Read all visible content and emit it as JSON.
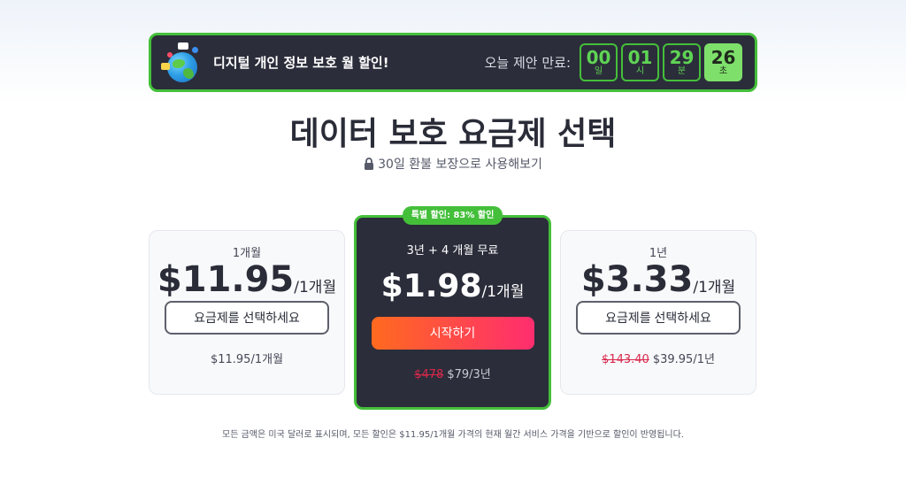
{
  "banner": {
    "text": "디지털 개인 정보 보호 월 할인!",
    "timer_label": "오늘 제안 만료:",
    "timer": [
      {
        "value": "00",
        "unit": "일"
      },
      {
        "value": "01",
        "unit": "시"
      },
      {
        "value": "29",
        "unit": "분"
      },
      {
        "value": "26",
        "unit": "초"
      }
    ]
  },
  "header": {
    "title": "데이터 보호 요금제 선택",
    "subtitle": "30일 환불 보장으로 사용해보기"
  },
  "plans": {
    "left": {
      "period": "1개월",
      "price": "$11.95",
      "unit": "/1개월",
      "button": "요금제를 선택하세요",
      "footer": "$11.95/1개월"
    },
    "middle": {
      "badge": "특별 할인: 83% 할인",
      "period": "3년 + 4 개월 무료",
      "price": "$1.98",
      "unit": "/1개월",
      "button": "시작하기",
      "old_price": "$478",
      "footer": "$79/3년"
    },
    "right": {
      "period": "1년",
      "price": "$3.33",
      "unit": "/1개월",
      "button": "요금제를 선택하세요",
      "old_price": "$143.40",
      "footer": "$39.95/1년"
    }
  },
  "note": "모든 금액은 미국 달러로 표시되며, 모든 할인은 $11.95/1개월 가격의 현재 월간 서비스 가격을 기반으로 할인이 반영됩니다.",
  "colors": {
    "accent_green": "#44bf3a",
    "dark_bg": "#2b2d3a",
    "cta_gradient_start": "#ff6a1f",
    "cta_gradient_end": "#ff2d6f",
    "strike_red": "#d8284b"
  }
}
